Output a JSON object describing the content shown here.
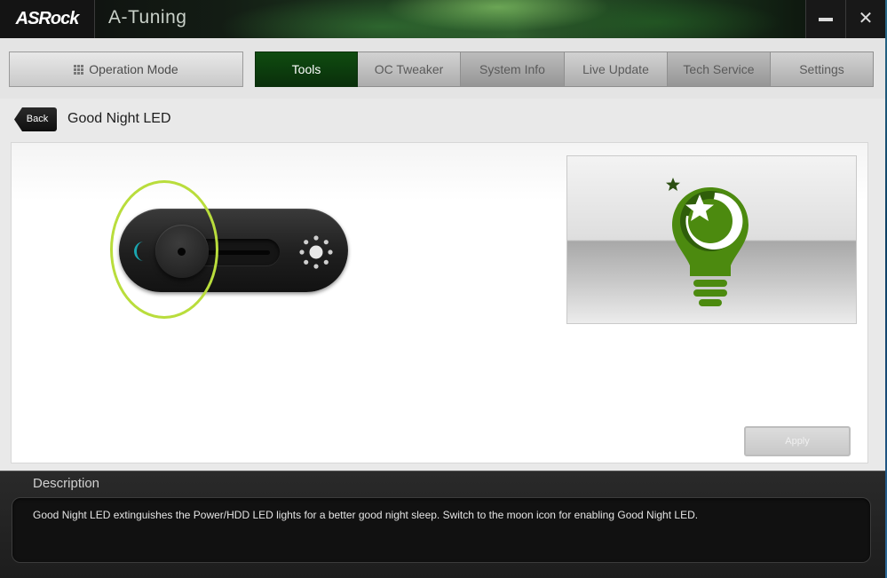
{
  "window": {
    "brand": "ASRock",
    "app_title": "A-Tuning",
    "minimize_icon": "minimize-icon",
    "close_icon": "close-icon",
    "close_glyph": "✕"
  },
  "nav": {
    "operation_mode": "Operation Mode",
    "tabs": [
      {
        "label": "Tools",
        "active": true
      },
      {
        "label": "OC Tweaker",
        "active": false
      },
      {
        "label": "System Info",
        "active": false
      },
      {
        "label": "Live Update",
        "active": false
      },
      {
        "label": "Tech Service",
        "active": false
      },
      {
        "label": "Settings",
        "active": false
      }
    ]
  },
  "breadcrumb": {
    "back_label": "Back",
    "page_title": "Good Night LED"
  },
  "toggle": {
    "state": "moon",
    "left_icon": "moon-icon",
    "right_icon": "sun-icon"
  },
  "illustration": {
    "icon": "lightbulb-moon-star-icon"
  },
  "actions": {
    "apply_label": "Apply",
    "apply_enabled": false
  },
  "description": {
    "title": "Description",
    "text": "Good Night LED extinguishes the Power/HDD LED lights for a better good night sleep. Switch to the moon icon for enabling Good Night LED."
  },
  "colors": {
    "accent_green": "#0f4c10",
    "moon_cyan": "#1aa6b0",
    "bulb_green": "#4c8a0f",
    "highlight": "#b9dd3c"
  }
}
